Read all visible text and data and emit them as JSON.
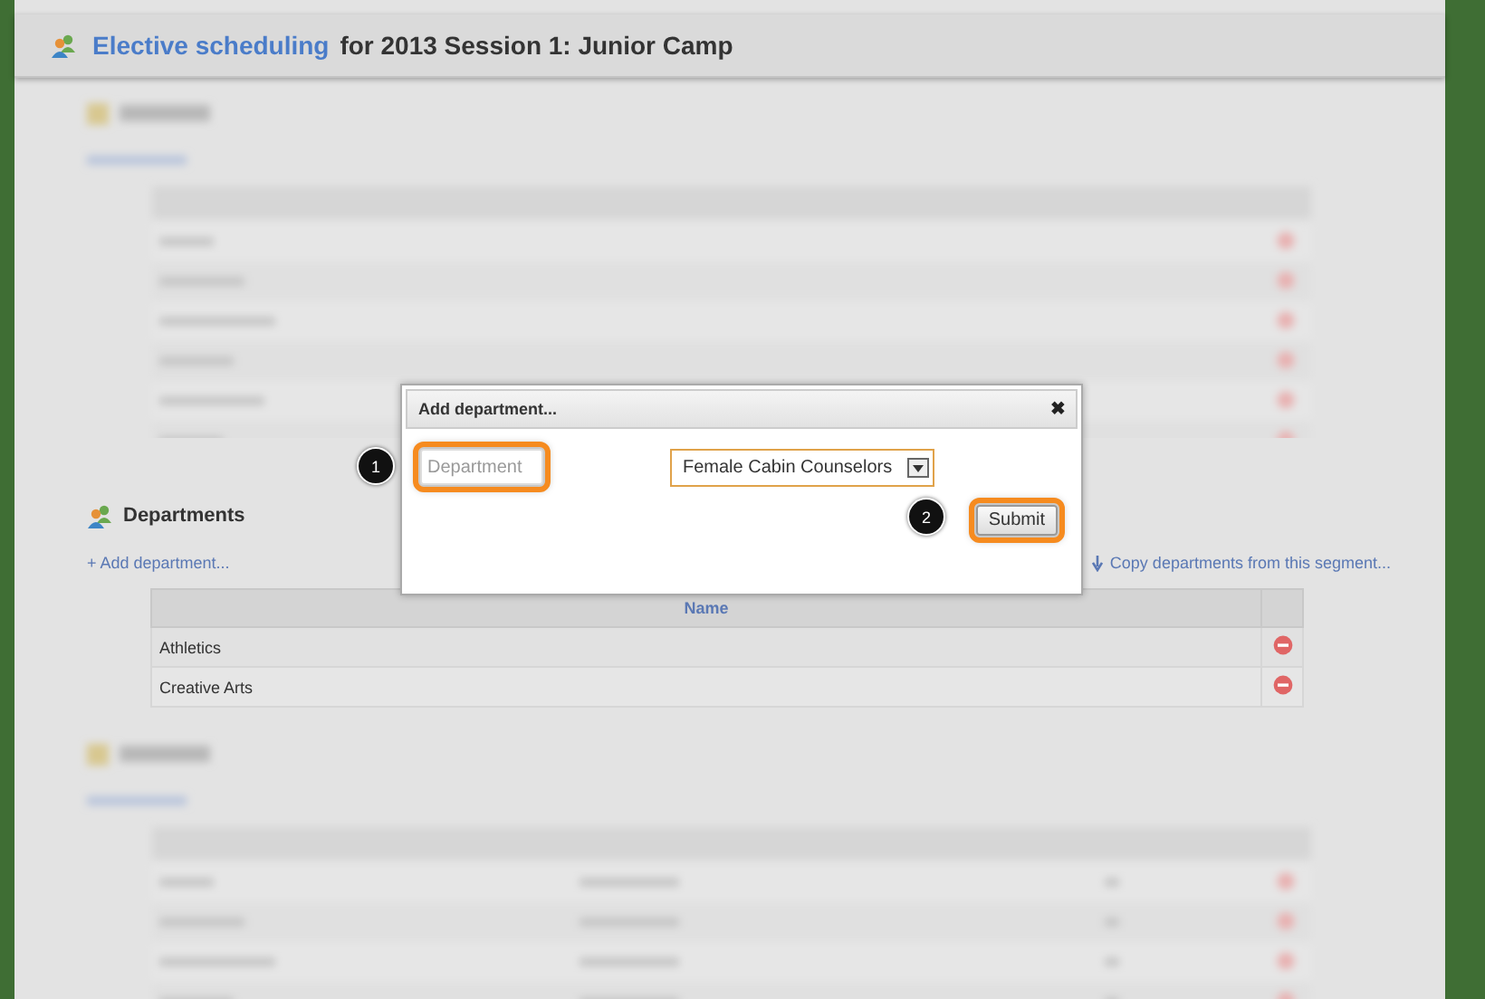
{
  "header": {
    "link": "Elective scheduling",
    "title": "for 2013 Session 1: Junior Camp"
  },
  "departments": {
    "title": "Departments",
    "add_link": "+ Add department...",
    "copy_link": "Copy departments from this segment...",
    "columns": [
      "Name"
    ],
    "rows": [
      "Athletics",
      "Creative Arts"
    ]
  },
  "dialog": {
    "title": "Add department...",
    "close": "✖",
    "field": {
      "placeholder": "Department",
      "highlighted": true
    },
    "select": {
      "value": "Female Cabin Counselors"
    },
    "submit": {
      "label": "Submit",
      "highlighted": true
    }
  },
  "callouts": [
    {
      "number": "1"
    },
    {
      "number": "2"
    }
  ]
}
